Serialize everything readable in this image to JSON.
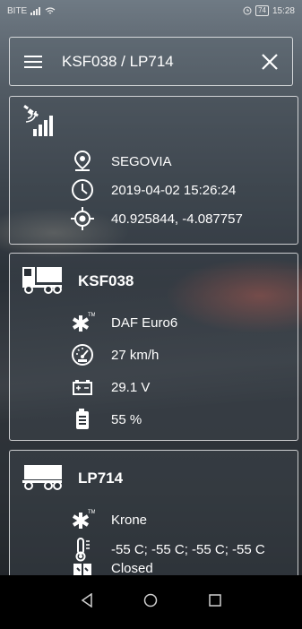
{
  "status_bar": {
    "carrier": "BITE",
    "battery": "74",
    "time": "15:28"
  },
  "header": {
    "title": "KSF038 / LP714"
  },
  "location_card": {
    "place": "SEGOVIA",
    "datetime": "2019-04-02 15:26:24",
    "coordinates": "40.925844, -4.087757"
  },
  "truck_card": {
    "title": "KSF038",
    "model": "DAF Euro6",
    "speed": "27 km/h",
    "voltage": "29.1 V",
    "fuel": "55 %"
  },
  "trailer_card": {
    "title": "LP714",
    "model": "Krone",
    "temperatures": "-55 C; -55 C; -55 C; -55 C",
    "door": "Closed"
  },
  "colors": {
    "card_border": "#ffffff",
    "nav_bar": "#000000"
  }
}
